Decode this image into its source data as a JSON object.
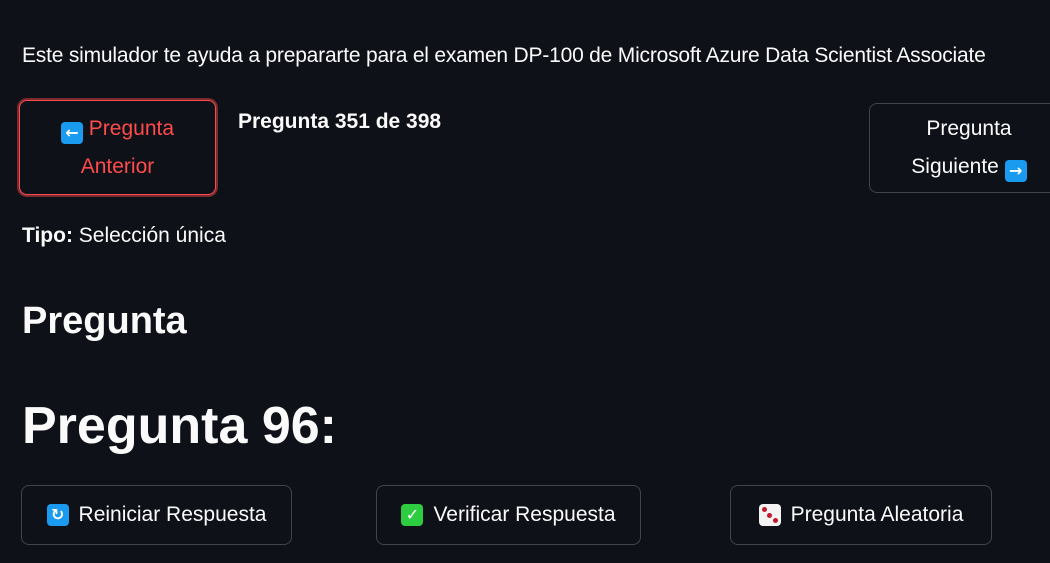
{
  "intro_text": "Este simulador te ayuda a prepararte para el examen DP-100 de Microsoft Azure Data Scientist Associate",
  "nav": {
    "prev_label_line1": "Pregunta",
    "prev_label_line2": "Anterior",
    "prev_icon": "left-arrow-icon",
    "next_label_line1": "Pregunta",
    "next_label_line2": "Siguiente",
    "next_icon": "right-arrow-icon",
    "counter": "Pregunta 351 de 398"
  },
  "tipo": {
    "label": "Tipo:",
    "value": "Selección única"
  },
  "section_heading": "Pregunta",
  "question_title": "Pregunta 96:",
  "actions": {
    "reset_label": "Reiniciar Respuesta",
    "reset_icon": "refresh-icon",
    "verify_label": "Verificar Respuesta",
    "verify_icon": "check-icon",
    "random_label": "Pregunta Aleatoria",
    "random_icon": "dice-icon"
  },
  "colors": {
    "background": "#0e1117",
    "text": "#fafafa",
    "accent_red": "#ff4b4b",
    "emoji_blue": "#1a9bf0",
    "emoji_green": "#2ecc40"
  }
}
